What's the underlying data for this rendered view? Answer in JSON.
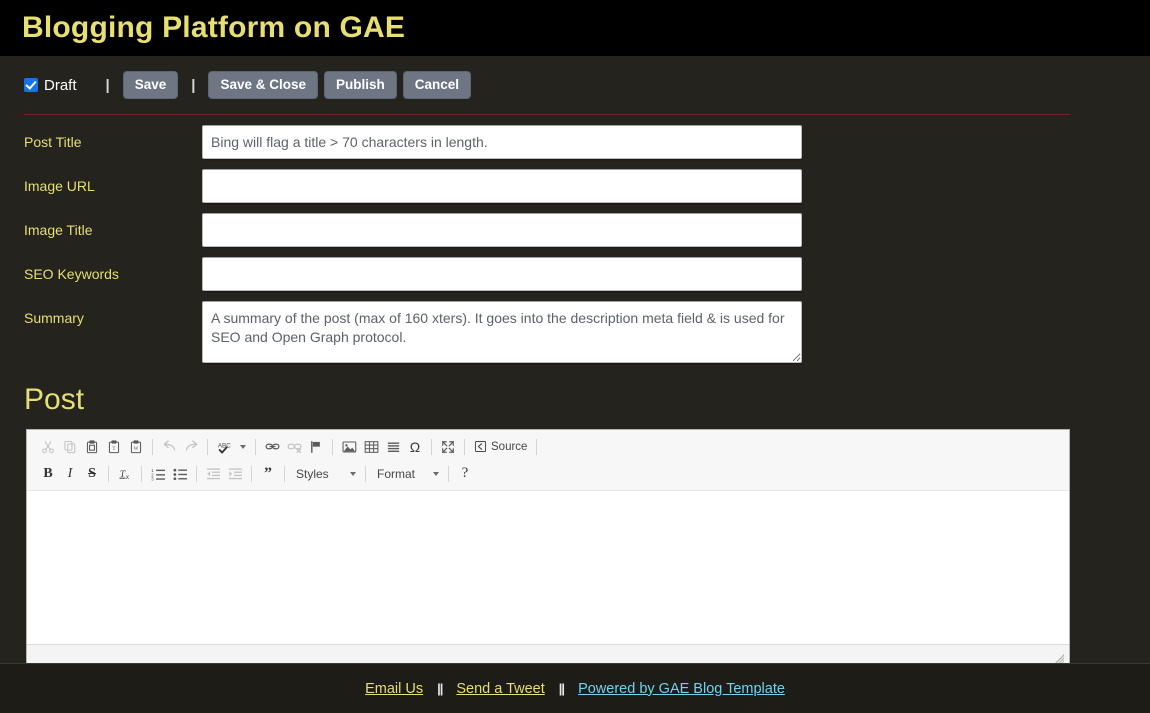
{
  "header": {
    "title": "Blogging Platform on GAE"
  },
  "actions": {
    "draft_label": "Draft",
    "draft_checked": true,
    "separator": "|",
    "save_label": "Save",
    "save_close_label": "Save & Close",
    "publish_label": "Publish",
    "cancel_label": "Cancel"
  },
  "form": {
    "fields": [
      {
        "label": "Post Title",
        "value": "",
        "placeholder": "Bing will flag a title > 70 characters in length.",
        "type": "text"
      },
      {
        "label": "Image URL",
        "value": "",
        "placeholder": "",
        "type": "text"
      },
      {
        "label": "Image Title",
        "value": "",
        "placeholder": "",
        "type": "text"
      },
      {
        "label": "SEO Keywords",
        "value": "",
        "placeholder": "",
        "type": "text"
      },
      {
        "label": "Summary",
        "value": "",
        "placeholder": "A summary of the post (max of 160 xters). It goes into the description meta field & is used for SEO and Open Graph protocol.",
        "type": "textarea"
      }
    ]
  },
  "post_section": {
    "heading": "Post"
  },
  "editor": {
    "content": "",
    "toolbar_row1": [
      {
        "name": "cut-icon",
        "title": "Cut",
        "disabled": true
      },
      {
        "name": "copy-icon",
        "title": "Copy",
        "disabled": true
      },
      {
        "name": "paste-icon",
        "title": "Paste",
        "disabled": false
      },
      {
        "name": "paste-as-text-icon",
        "title": "Paste as plain text",
        "disabled": false
      },
      {
        "name": "paste-from-word-icon",
        "title": "Paste from Word",
        "disabled": false
      },
      {
        "name": "separator",
        "title": "",
        "disabled": false
      },
      {
        "name": "undo-icon",
        "title": "Undo",
        "disabled": true
      },
      {
        "name": "redo-icon",
        "title": "Redo",
        "disabled": true
      },
      {
        "name": "separator",
        "title": "",
        "disabled": false
      },
      {
        "name": "spellcheck-icon",
        "title": "Spell Check As You Type",
        "disabled": false
      },
      {
        "name": "separator",
        "title": "",
        "disabled": false
      },
      {
        "name": "link-icon",
        "title": "Link",
        "disabled": false
      },
      {
        "name": "unlink-icon",
        "title": "Unlink",
        "disabled": true
      },
      {
        "name": "anchor-icon",
        "title": "Anchor",
        "disabled": false
      },
      {
        "name": "separator",
        "title": "",
        "disabled": false
      },
      {
        "name": "image-icon",
        "title": "Image",
        "disabled": false
      },
      {
        "name": "table-icon",
        "title": "Table",
        "disabled": false
      },
      {
        "name": "horizontal-rule-icon",
        "title": "Horizontal Line",
        "disabled": false
      },
      {
        "name": "special-char-icon",
        "title": "Insert Special Character",
        "disabled": false
      },
      {
        "name": "separator",
        "title": "",
        "disabled": false
      },
      {
        "name": "maximize-icon",
        "title": "Maximize",
        "disabled": false
      },
      {
        "name": "separator",
        "title": "",
        "disabled": false
      },
      {
        "name": "source-icon",
        "title": "Source",
        "disabled": false
      }
    ],
    "source_label": "Source",
    "spellcheck_label": "ABC",
    "toolbar_row2": [
      {
        "name": "bold-icon",
        "title": "Bold",
        "disabled": false
      },
      {
        "name": "italic-icon",
        "title": "Italic",
        "disabled": false
      },
      {
        "name": "strikethrough-icon",
        "title": "Strikethrough",
        "disabled": false
      },
      {
        "name": "separator",
        "title": "",
        "disabled": false
      },
      {
        "name": "remove-format-icon",
        "title": "Remove Format",
        "disabled": false
      },
      {
        "name": "separator",
        "title": "",
        "disabled": false
      },
      {
        "name": "numbered-list-icon",
        "title": "Insert/Remove Numbered List",
        "disabled": false
      },
      {
        "name": "bulleted-list-icon",
        "title": "Insert/Remove Bulleted List",
        "disabled": false
      },
      {
        "name": "separator",
        "title": "",
        "disabled": false
      },
      {
        "name": "decrease-indent-icon",
        "title": "Decrease Indent",
        "disabled": true
      },
      {
        "name": "increase-indent-icon",
        "title": "Increase Indent",
        "disabled": true
      },
      {
        "name": "separator",
        "title": "",
        "disabled": false
      },
      {
        "name": "blockquote-icon",
        "title": "Block Quote",
        "disabled": false
      }
    ],
    "styles_label": "Styles",
    "format_label": "Format",
    "help_label": "?"
  },
  "footer": {
    "links": [
      {
        "label": "Email Us",
        "style": "yellow"
      },
      {
        "label": "Send a Tweet",
        "style": "yellow"
      },
      {
        "label": "Powered by GAE Blog Template",
        "style": "cyan"
      }
    ],
    "separator": "||"
  },
  "colors": {
    "header_bg": "#000000",
    "page_bg": "#24231e",
    "accent_yellow": "#e8df72",
    "accent_cyan": "#6fd4ee",
    "button_bg": "#6d7682",
    "divider_red": "#7e1f1f",
    "checkbox_blue": "#1673e8"
  }
}
